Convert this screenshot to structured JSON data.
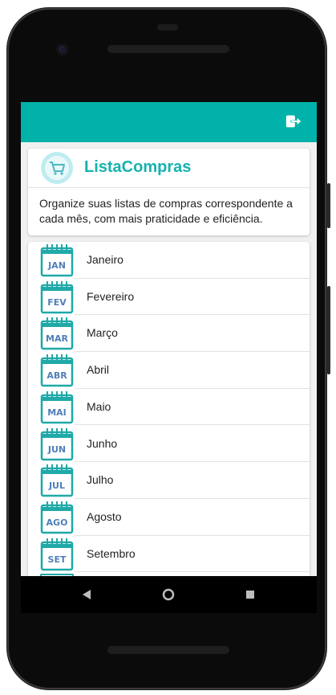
{
  "app": {
    "title": "ListaCompras",
    "description": "Organize suas listas de compras correspondente a cada mês, com mais praticidade e eficiência.",
    "accent_color": "#00b2a9"
  },
  "toolbar": {
    "exit_icon": "logout-icon"
  },
  "months": [
    {
      "abbr": "JAN",
      "label": "Janeiro"
    },
    {
      "abbr": "FEV",
      "label": "Fevereiro"
    },
    {
      "abbr": "MAR",
      "label": "Março"
    },
    {
      "abbr": "ABR",
      "label": "Abril"
    },
    {
      "abbr": "MAI",
      "label": "Maio"
    },
    {
      "abbr": "JUN",
      "label": "Junho"
    },
    {
      "abbr": "JUL",
      "label": "Julho"
    },
    {
      "abbr": "AGO",
      "label": "Agosto"
    },
    {
      "abbr": "SET",
      "label": "Setembro"
    }
  ],
  "nav": {
    "back_icon": "back-triangle-icon",
    "home_icon": "home-circle-icon",
    "recents_icon": "recents-square-icon"
  }
}
